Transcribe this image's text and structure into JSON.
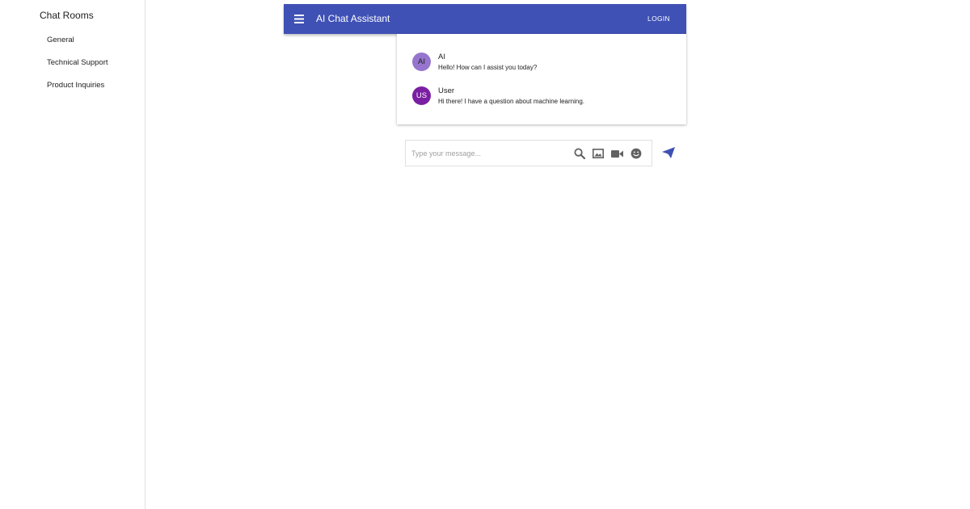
{
  "sidebar": {
    "title": "Chat Rooms",
    "rooms": [
      {
        "label": "General"
      },
      {
        "label": "Technical Support"
      },
      {
        "label": "Product Inquiries"
      }
    ]
  },
  "appbar": {
    "menu_icon": "menu-icon",
    "title": "AI Chat Assistant",
    "login_label": "LOGIN"
  },
  "messages": [
    {
      "avatar": "AI",
      "author": "AI",
      "text": "Hello! How can I assist you today?"
    },
    {
      "avatar": "US",
      "author": "User",
      "text": "Hi there! I have a question about machine learning."
    }
  ],
  "composer": {
    "placeholder": "Type your message...",
    "value": "",
    "tools": [
      "search-icon",
      "image-icon",
      "video-icon",
      "emoji-icon"
    ],
    "send_icon": "send-icon"
  },
  "colors": {
    "primary": "#3f51b5",
    "avatar_ai": "#9575cd",
    "avatar_user": "#7b1fa2",
    "icon_gray": "#616161"
  }
}
